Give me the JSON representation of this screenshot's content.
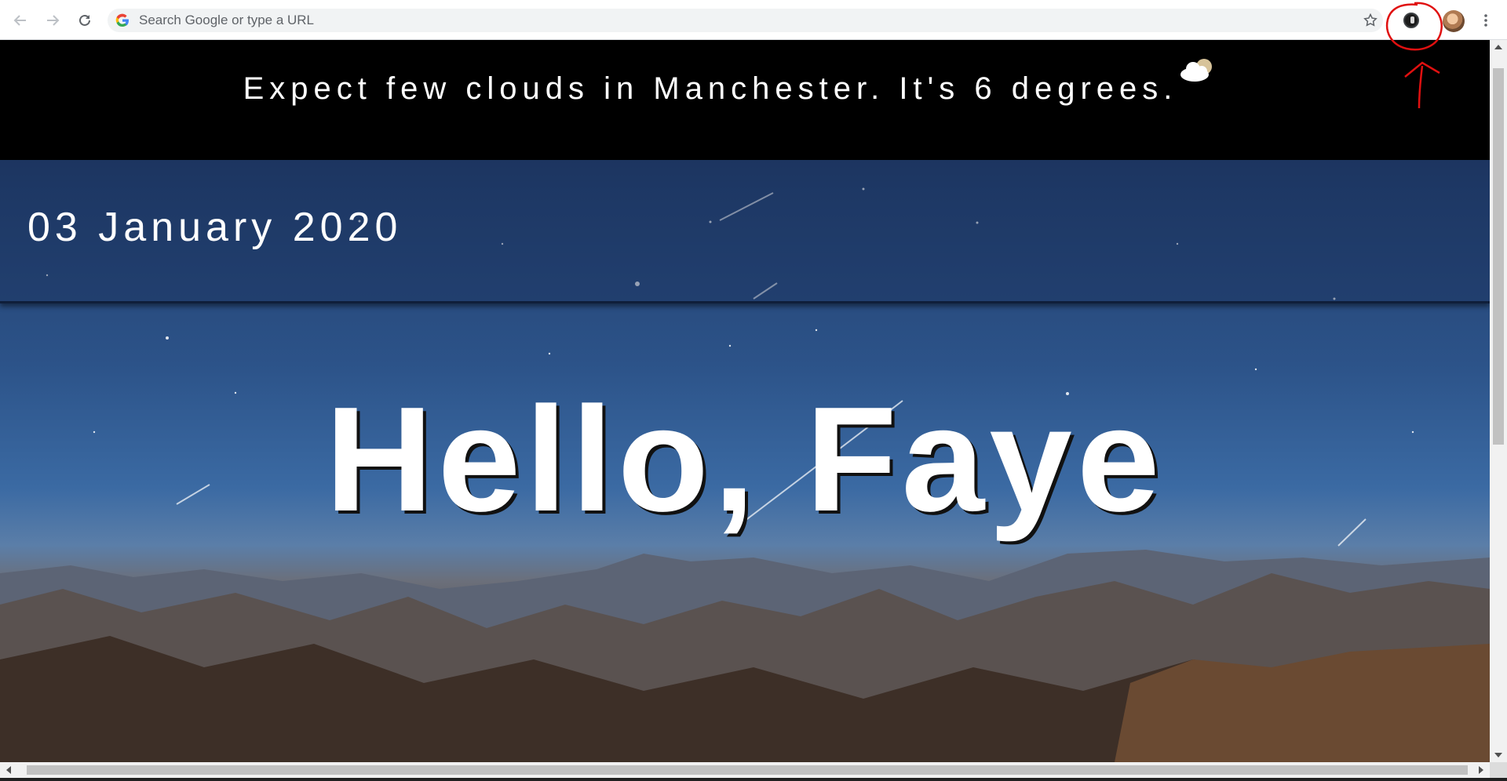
{
  "browser": {
    "omnibox": {
      "placeholder": "Search Google or type a URL",
      "value": ""
    },
    "icons": {
      "back": "arrow-left-icon",
      "forward": "arrow-right-icon",
      "reload": "reload-icon",
      "google": "google-g-icon",
      "bookmark": "star-icon",
      "extension": "extension-icon",
      "profile": "profile-avatar",
      "menu": "kebab-menu-icon"
    },
    "annotation_color": "#e01010"
  },
  "page": {
    "weather": {
      "text": "Expect few clouds in Manchester. It's 6 degrees.",
      "icon": "few-clouds-icon"
    },
    "date": "03 January 2020",
    "greeting": "Hello, Faye"
  },
  "colors": {
    "weather_bar": "#000000",
    "text": "#ffffff",
    "sky_top": "#1a2a4a",
    "sky_mid": "#2c5389"
  }
}
